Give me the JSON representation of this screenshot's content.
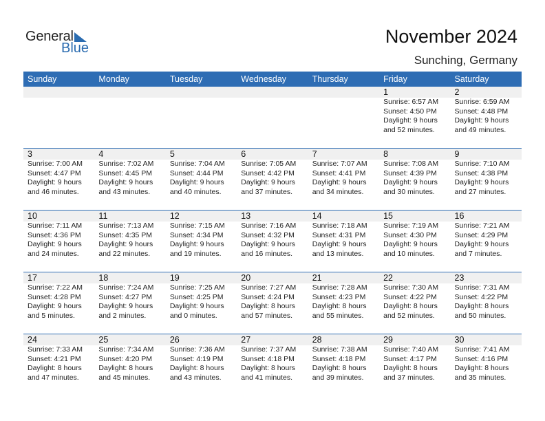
{
  "brand": {
    "word1": "General",
    "word2": "Blue",
    "accent_color": "#2e6db4"
  },
  "title": "November 2024",
  "location": "Sunching, Germany",
  "weekdays": [
    "Sunday",
    "Monday",
    "Tuesday",
    "Wednesday",
    "Thursday",
    "Friday",
    "Saturday"
  ],
  "weeks": [
    [
      {
        "day": "",
        "sunrise": "",
        "sunset": "",
        "daylight": "",
        "minutes": ""
      },
      {
        "day": "",
        "sunrise": "",
        "sunset": "",
        "daylight": "",
        "minutes": ""
      },
      {
        "day": "",
        "sunrise": "",
        "sunset": "",
        "daylight": "",
        "minutes": ""
      },
      {
        "day": "",
        "sunrise": "",
        "sunset": "",
        "daylight": "",
        "minutes": ""
      },
      {
        "day": "",
        "sunrise": "",
        "sunset": "",
        "daylight": "",
        "minutes": ""
      },
      {
        "day": "1",
        "sunrise": "Sunrise: 6:57 AM",
        "sunset": "Sunset: 4:50 PM",
        "daylight": "Daylight: 9 hours",
        "minutes": "and 52 minutes."
      },
      {
        "day": "2",
        "sunrise": "Sunrise: 6:59 AM",
        "sunset": "Sunset: 4:48 PM",
        "daylight": "Daylight: 9 hours",
        "minutes": "and 49 minutes."
      }
    ],
    [
      {
        "day": "3",
        "sunrise": "Sunrise: 7:00 AM",
        "sunset": "Sunset: 4:47 PM",
        "daylight": "Daylight: 9 hours",
        "minutes": "and 46 minutes."
      },
      {
        "day": "4",
        "sunrise": "Sunrise: 7:02 AM",
        "sunset": "Sunset: 4:45 PM",
        "daylight": "Daylight: 9 hours",
        "minutes": "and 43 minutes."
      },
      {
        "day": "5",
        "sunrise": "Sunrise: 7:04 AM",
        "sunset": "Sunset: 4:44 PM",
        "daylight": "Daylight: 9 hours",
        "minutes": "and 40 minutes."
      },
      {
        "day": "6",
        "sunrise": "Sunrise: 7:05 AM",
        "sunset": "Sunset: 4:42 PM",
        "daylight": "Daylight: 9 hours",
        "minutes": "and 37 minutes."
      },
      {
        "day": "7",
        "sunrise": "Sunrise: 7:07 AM",
        "sunset": "Sunset: 4:41 PM",
        "daylight": "Daylight: 9 hours",
        "minutes": "and 34 minutes."
      },
      {
        "day": "8",
        "sunrise": "Sunrise: 7:08 AM",
        "sunset": "Sunset: 4:39 PM",
        "daylight": "Daylight: 9 hours",
        "minutes": "and 30 minutes."
      },
      {
        "day": "9",
        "sunrise": "Sunrise: 7:10 AM",
        "sunset": "Sunset: 4:38 PM",
        "daylight": "Daylight: 9 hours",
        "minutes": "and 27 minutes."
      }
    ],
    [
      {
        "day": "10",
        "sunrise": "Sunrise: 7:11 AM",
        "sunset": "Sunset: 4:36 PM",
        "daylight": "Daylight: 9 hours",
        "minutes": "and 24 minutes."
      },
      {
        "day": "11",
        "sunrise": "Sunrise: 7:13 AM",
        "sunset": "Sunset: 4:35 PM",
        "daylight": "Daylight: 9 hours",
        "minutes": "and 22 minutes."
      },
      {
        "day": "12",
        "sunrise": "Sunrise: 7:15 AM",
        "sunset": "Sunset: 4:34 PM",
        "daylight": "Daylight: 9 hours",
        "minutes": "and 19 minutes."
      },
      {
        "day": "13",
        "sunrise": "Sunrise: 7:16 AM",
        "sunset": "Sunset: 4:32 PM",
        "daylight": "Daylight: 9 hours",
        "minutes": "and 16 minutes."
      },
      {
        "day": "14",
        "sunrise": "Sunrise: 7:18 AM",
        "sunset": "Sunset: 4:31 PM",
        "daylight": "Daylight: 9 hours",
        "minutes": "and 13 minutes."
      },
      {
        "day": "15",
        "sunrise": "Sunrise: 7:19 AM",
        "sunset": "Sunset: 4:30 PM",
        "daylight": "Daylight: 9 hours",
        "minutes": "and 10 minutes."
      },
      {
        "day": "16",
        "sunrise": "Sunrise: 7:21 AM",
        "sunset": "Sunset: 4:29 PM",
        "daylight": "Daylight: 9 hours",
        "minutes": "and 7 minutes."
      }
    ],
    [
      {
        "day": "17",
        "sunrise": "Sunrise: 7:22 AM",
        "sunset": "Sunset: 4:28 PM",
        "daylight": "Daylight: 9 hours",
        "minutes": "and 5 minutes."
      },
      {
        "day": "18",
        "sunrise": "Sunrise: 7:24 AM",
        "sunset": "Sunset: 4:27 PM",
        "daylight": "Daylight: 9 hours",
        "minutes": "and 2 minutes."
      },
      {
        "day": "19",
        "sunrise": "Sunrise: 7:25 AM",
        "sunset": "Sunset: 4:25 PM",
        "daylight": "Daylight: 9 hours",
        "minutes": "and 0 minutes."
      },
      {
        "day": "20",
        "sunrise": "Sunrise: 7:27 AM",
        "sunset": "Sunset: 4:24 PM",
        "daylight": "Daylight: 8 hours",
        "minutes": "and 57 minutes."
      },
      {
        "day": "21",
        "sunrise": "Sunrise: 7:28 AM",
        "sunset": "Sunset: 4:23 PM",
        "daylight": "Daylight: 8 hours",
        "minutes": "and 55 minutes."
      },
      {
        "day": "22",
        "sunrise": "Sunrise: 7:30 AM",
        "sunset": "Sunset: 4:22 PM",
        "daylight": "Daylight: 8 hours",
        "minutes": "and 52 minutes."
      },
      {
        "day": "23",
        "sunrise": "Sunrise: 7:31 AM",
        "sunset": "Sunset: 4:22 PM",
        "daylight": "Daylight: 8 hours",
        "minutes": "and 50 minutes."
      }
    ],
    [
      {
        "day": "24",
        "sunrise": "Sunrise: 7:33 AM",
        "sunset": "Sunset: 4:21 PM",
        "daylight": "Daylight: 8 hours",
        "minutes": "and 47 minutes."
      },
      {
        "day": "25",
        "sunrise": "Sunrise: 7:34 AM",
        "sunset": "Sunset: 4:20 PM",
        "daylight": "Daylight: 8 hours",
        "minutes": "and 45 minutes."
      },
      {
        "day": "26",
        "sunrise": "Sunrise: 7:36 AM",
        "sunset": "Sunset: 4:19 PM",
        "daylight": "Daylight: 8 hours",
        "minutes": "and 43 minutes."
      },
      {
        "day": "27",
        "sunrise": "Sunrise: 7:37 AM",
        "sunset": "Sunset: 4:18 PM",
        "daylight": "Daylight: 8 hours",
        "minutes": "and 41 minutes."
      },
      {
        "day": "28",
        "sunrise": "Sunrise: 7:38 AM",
        "sunset": "Sunset: 4:18 PM",
        "daylight": "Daylight: 8 hours",
        "minutes": "and 39 minutes."
      },
      {
        "day": "29",
        "sunrise": "Sunrise: 7:40 AM",
        "sunset": "Sunset: 4:17 PM",
        "daylight": "Daylight: 8 hours",
        "minutes": "and 37 minutes."
      },
      {
        "day": "30",
        "sunrise": "Sunrise: 7:41 AM",
        "sunset": "Sunset: 4:16 PM",
        "daylight": "Daylight: 8 hours",
        "minutes": "and 35 minutes."
      }
    ]
  ]
}
